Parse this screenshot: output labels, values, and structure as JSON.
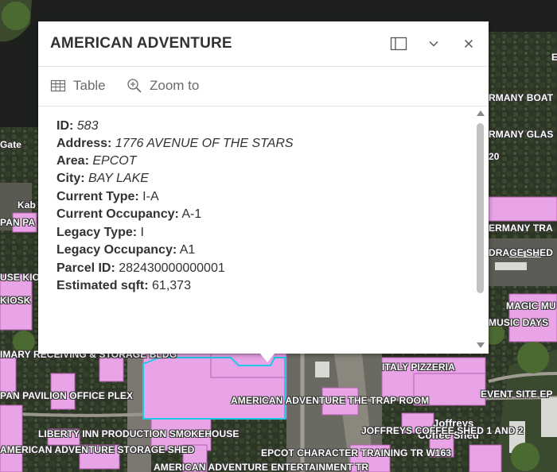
{
  "popup": {
    "title": "AMERICAN ADVENTURE",
    "dock_icon": "dock-side-icon",
    "collapse_icon": "chevron-down-icon",
    "close_icon": "close-icon",
    "actions": [
      {
        "label": "Table",
        "icon": "table-icon"
      },
      {
        "label": "Zoom to",
        "icon": "zoom-to-icon"
      }
    ],
    "fields": [
      {
        "label": "ID:",
        "value": "583",
        "italic": true
      },
      {
        "label": "Address:",
        "value": "1776 AVENUE OF THE STARS",
        "italic": true
      },
      {
        "label": "Area:",
        "value": "EPCOT",
        "italic": true
      },
      {
        "label": "City:",
        "value": "BAY LAKE",
        "italic": true
      },
      {
        "label": "Current Type:",
        "value": "I-A",
        "italic": false
      },
      {
        "label": "Current Occupancy:",
        "value": "A-1",
        "italic": false
      },
      {
        "label": "Legacy Type:",
        "value": "I",
        "italic": false
      },
      {
        "label": "Legacy Occupancy:",
        "value": "A1",
        "italic": false
      },
      {
        "label": "Parcel ID:",
        "value": "282430000000001",
        "italic": false
      },
      {
        "label": "Estimated sqft:",
        "value": "61,373",
        "italic": false
      }
    ]
  },
  "map": {
    "labels": [
      "Gate",
      "Kab",
      "PAN PA",
      "USE KIO",
      "KIOSK",
      "RMANY BOAT",
      "RMANY GLAS",
      "20",
      "ERMANY TRA",
      "DRAGE SHED",
      "MAGIC MU",
      "MUSIC DAYS",
      "IMARY RECEIVING & STORAGE BLDG",
      "ITALY PIZZERIA",
      "PAN PAVILION OFFICE PLEX",
      "EVENT SITE EP",
      "AMERICAN ADVENTURE THE TRAP ROOM",
      "Joffreys",
      "Coffee Shed",
      "JOFFREYS COFFEE SHED 1 AND 2",
      "LIBERTY INN PRODUCTION SMOKEHOUSE",
      "AMERICAN ADVENTURE STORAGE SHED",
      "EPCOT CHARACTER TRAINING TR W163",
      "AMERICAN ADVENTURE ENTERTAINMENT TR",
      "E"
    ],
    "colors": {
      "building_fill": "#e8a4e6",
      "building_stroke": "#b760b3",
      "selection": "#20c8e8",
      "water": "#1a1d1a",
      "vegetation": "#2f3a26"
    }
  }
}
